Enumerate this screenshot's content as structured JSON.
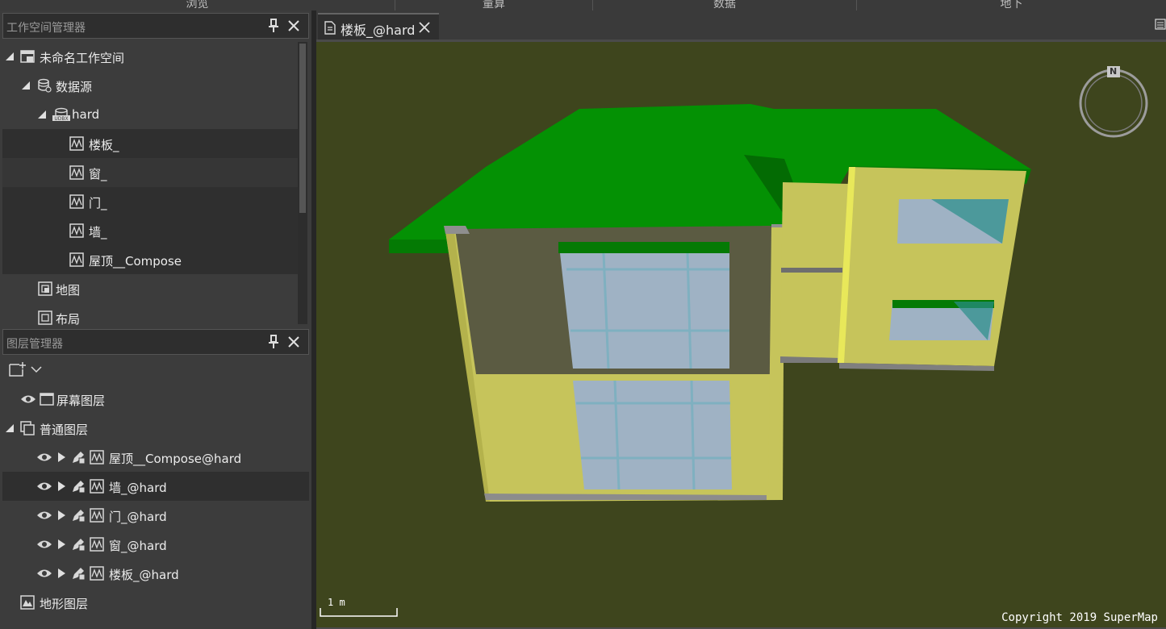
{
  "top_menu": [
    "浏览",
    "量算",
    "数据",
    "地下"
  ],
  "workspace_panel": {
    "title": "工作空间管理器",
    "items": [
      {
        "label": "未命名工作空间"
      },
      {
        "label": "数据源"
      },
      {
        "label": "hard"
      },
      {
        "label": "楼板_"
      },
      {
        "label": "窗_"
      },
      {
        "label": "门_"
      },
      {
        "label": "墙_"
      },
      {
        "label": "屋顶__Compose"
      },
      {
        "label": "地图"
      },
      {
        "label": "布局"
      }
    ]
  },
  "layer_panel": {
    "title": "图层管理器",
    "items": [
      {
        "label": "屏幕图层"
      },
      {
        "label": "普通图层"
      },
      {
        "label": "屋顶__Compose@hard"
      },
      {
        "label": "墙_@hard"
      },
      {
        "label": "门_@hard"
      },
      {
        "label": "窗_@hard"
      },
      {
        "label": "楼板_@hard"
      },
      {
        "label": "地形图层"
      }
    ]
  },
  "document_tab": {
    "label": "楼板_@hard"
  },
  "scene": {
    "compass_label": "N",
    "scale_label": "1 m",
    "copyright": "Copyright 2019 SuperMap",
    "background_color": "#3e451d",
    "roof_color": "#049104",
    "wall_color": "#c6c45b"
  },
  "icons": [
    "pin-icon",
    "close-icon",
    "workspace-icon",
    "datasource-icon",
    "udbx-icon",
    "dataset-icon",
    "map-icon",
    "layout-icon",
    "eye-icon",
    "screen-layer-icon",
    "layer-group-icon",
    "terrain-layer-icon",
    "edit-icon",
    "add-layer-icon",
    "document-icon",
    "menu-icon"
  ]
}
